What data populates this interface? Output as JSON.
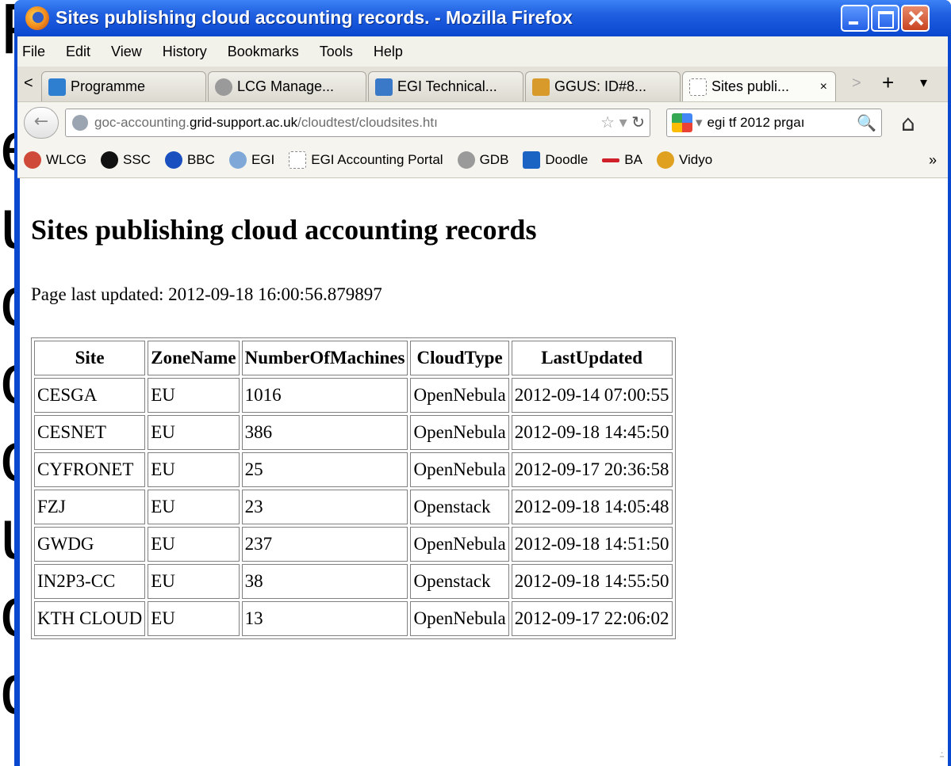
{
  "background_fragments": [
    "F",
    "e",
    "u",
    "c",
    "c",
    "o",
    "u",
    "o",
    "d"
  ],
  "window": {
    "title": "Sites publishing cloud accounting records. - Mozilla Firefox"
  },
  "menu": [
    "File",
    "Edit",
    "View",
    "History",
    "Bookmarks",
    "Tools",
    "Help"
  ],
  "tabs": [
    {
      "label": "Programme",
      "icon": "egi-icon",
      "color": "#2e7fd0"
    },
    {
      "label": "LCG Manage...",
      "icon": "lcg-icon",
      "color": "#9a9a9a"
    },
    {
      "label": "EGI Technical...",
      "icon": "egi-tech-icon",
      "color": "#3a78c8"
    },
    {
      "label": "GGUS: ID#8...",
      "icon": "ggus-icon",
      "color": "#d89a2a"
    },
    {
      "label": "Sites publi...",
      "icon": "blank-page-icon",
      "color": "#ffffff",
      "close": "×"
    }
  ],
  "tab_controls": {
    "scroll_left": "<",
    "scroll_right": ">",
    "new_tab": "+",
    "list": "▾"
  },
  "navigation": {
    "url_host": "goc-accounting.",
    "url_domain": "grid-support.ac.uk",
    "url_path": "/cloudtest/cloudsites.htı",
    "search_text": "egi tf 2012 prgaı"
  },
  "bookmarks": [
    {
      "label": "WLCG",
      "color": "#d04a3a"
    },
    {
      "label": "SSC",
      "color": "#111111"
    },
    {
      "label": "BBC",
      "color": "#1a4fbf"
    },
    {
      "label": "EGI",
      "color": "#7fa8d8"
    },
    {
      "label": "EGI Accounting Portal",
      "color": "#ffffff"
    },
    {
      "label": "GDB",
      "color": "#9a9a9a"
    },
    {
      "label": "Doodle",
      "color": "#1b64c4"
    },
    {
      "label": "BA",
      "color": "#d0202a"
    },
    {
      "label": "Vidyo",
      "color": "#e0a020"
    }
  ],
  "bookmarks_more": "»",
  "page": {
    "heading": "Sites publishing cloud accounting records",
    "updated": "Page last updated: 2012-09-18 16:00:56.879897",
    "columns": [
      "Site",
      "ZoneName",
      "NumberOfMachines",
      "CloudType",
      "LastUpdated"
    ],
    "rows": [
      [
        "CESGA",
        "EU",
        "1016",
        "OpenNebula",
        "2012-09-14 07:00:55"
      ],
      [
        "CESNET",
        "EU",
        "386",
        "OpenNebula",
        "2012-09-18 14:45:50"
      ],
      [
        "CYFRONET",
        "EU",
        "25",
        "OpenNebula",
        "2012-09-17 20:36:58"
      ],
      [
        "FZJ",
        "EU",
        "23",
        "Openstack",
        "2012-09-18 14:05:48"
      ],
      [
        "GWDG",
        "EU",
        "237",
        "OpenNebula",
        "2012-09-18 14:51:50"
      ],
      [
        "IN2P3-CC",
        "EU",
        "38",
        "Openstack",
        "2012-09-18 14:55:50"
      ],
      [
        "KTH CLOUD",
        "EU",
        "13",
        "OpenNebula",
        "2012-09-17 22:06:02"
      ]
    ]
  }
}
